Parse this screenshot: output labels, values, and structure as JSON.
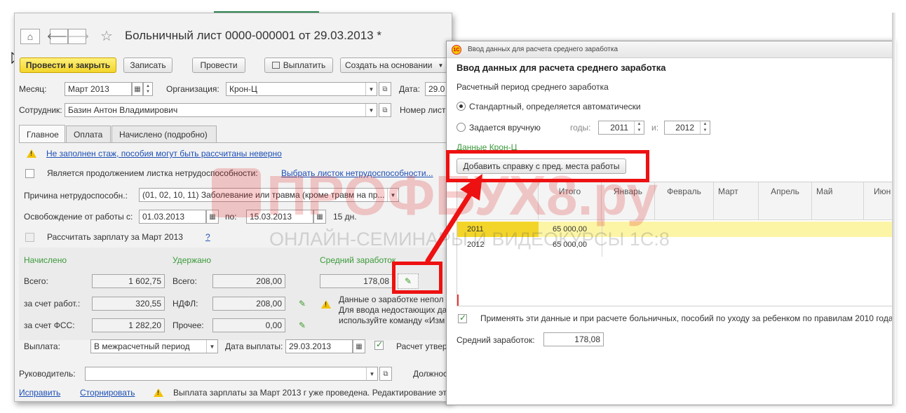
{
  "main_window": {
    "title": "Больничный лист 0000-000001 от 29.03.2013 *",
    "nav": {
      "home": "⌂",
      "back": "🡐",
      "forward": "🡒",
      "star": "☆"
    },
    "toolbar": {
      "post_close": "Провести и закрыть",
      "save": "Записать",
      "post": "Провести",
      "pay": "Выплатить",
      "create_based": "Создать на основании"
    },
    "header": {
      "month_label": "Месяц:",
      "month_value": "Март 2013",
      "org_label": "Организация:",
      "org_value": "Крон-Ц",
      "date_label": "Дата:",
      "date_value": "29.0",
      "employee_label": "Сотрудник:",
      "employee_value": "Базин Антон Владимирович",
      "number_label": "Номер лист"
    },
    "tabs": [
      "Главное",
      "Оплата",
      "Начислено (подробно)"
    ],
    "main_tab": {
      "warning_link": "Не заполнен стаж, пособия могут быть рассчитаны неверно",
      "continuation_label": "Является продолжением листка нетрудоспособности:",
      "continuation_link": "Выбрать листок нетрудоспособности...",
      "reason_label": "Причина нетрудоспособн.:",
      "reason_value": "(01, 02, 10, 11) Заболевание или травма (кроме травм на пр...",
      "release_label": "Освобождение от работы с:",
      "release_from": "01.03.2013",
      "release_to_label": "по:",
      "release_to": "15.03.2013",
      "days": "15 дн.",
      "calc_salary_label": "Рассчитать зарплату за Март 2013",
      "help": "?",
      "accrued_title": "Начислено",
      "withheld_title": "Удержано",
      "avg_title": "Средний заработок",
      "total_label": "Всего:",
      "total_value": "1 602,75",
      "employer_label": "за счет работ.:",
      "employer_value": "320,55",
      "fss_label": "за счет ФСС:",
      "fss_value": "1 282,20",
      "withheld_total_label": "Всего:",
      "withheld_total_value": "208,00",
      "ndfl_label": "НДФЛ:",
      "ndfl_value": "208,00",
      "other_label": "Прочее:",
      "other_value": "0,00",
      "avg_value": "178,08",
      "avg_note_1": "Данные о заработке непол",
      "avg_note_2": "Для ввода недостающих да",
      "avg_note_3": "используйте команду «Изм",
      "payout_label": "Выплата:",
      "payout_value": "В межрасчетный период",
      "payout_date_label": "Дата выплаты:",
      "payout_date_value": "29.03.2013",
      "calc_confirm_label": "Расчет утвер"
    },
    "footer": {
      "manager_label": "Руководитель:",
      "position_label": "Должнос",
      "fix_link": "Исправить",
      "reverse_link": "Сторнировать",
      "footer_warning": "Выплата зарплаты за Март 2013 г уже проведена. Редактирование эт"
    }
  },
  "dialog": {
    "titlebar_text": "Ввод данных для расчета среднего заработка",
    "title": "Ввод данных для расчета среднего заработка",
    "period_label": "Расчетный период среднего заработка",
    "radio_standard": "Стандартный, определяется автоматически",
    "radio_manual": "Задается вручную",
    "years_label": "годы:",
    "year_from": "2011",
    "to_label": "и:",
    "year_to": "2012",
    "org_section": "Данные Крон-Ц",
    "add_button": "Добавить справку с пред. места работы",
    "table": {
      "columns": [
        "Итого",
        "Январь",
        "Февраль",
        "Март",
        "Апрель",
        "Май",
        "Июн"
      ],
      "rows": [
        {
          "year": "2011",
          "total": "65 000,00"
        },
        {
          "year": "2012",
          "total": "65 000,00"
        }
      ]
    },
    "apply_label": "Применять эти данные и при расчете больничных, пособий по уходу за ребенком по правилам 2010 года",
    "avg_label": "Средний заработок:",
    "avg_value": "178,08"
  },
  "watermark": {
    "big": "ПРОФБУХ8.ру",
    "small": "ОНЛАЙН-СЕМИНАРЫ И ВИДЕОКУРСЫ 1С:8"
  },
  "colors": {
    "accent_yellow": "#f3d52a",
    "highlight_red": "#ee1111",
    "link_blue": "#1d4fb5",
    "section_green": "#3a9a3a",
    "row_highlight": "#fdf5a6"
  }
}
